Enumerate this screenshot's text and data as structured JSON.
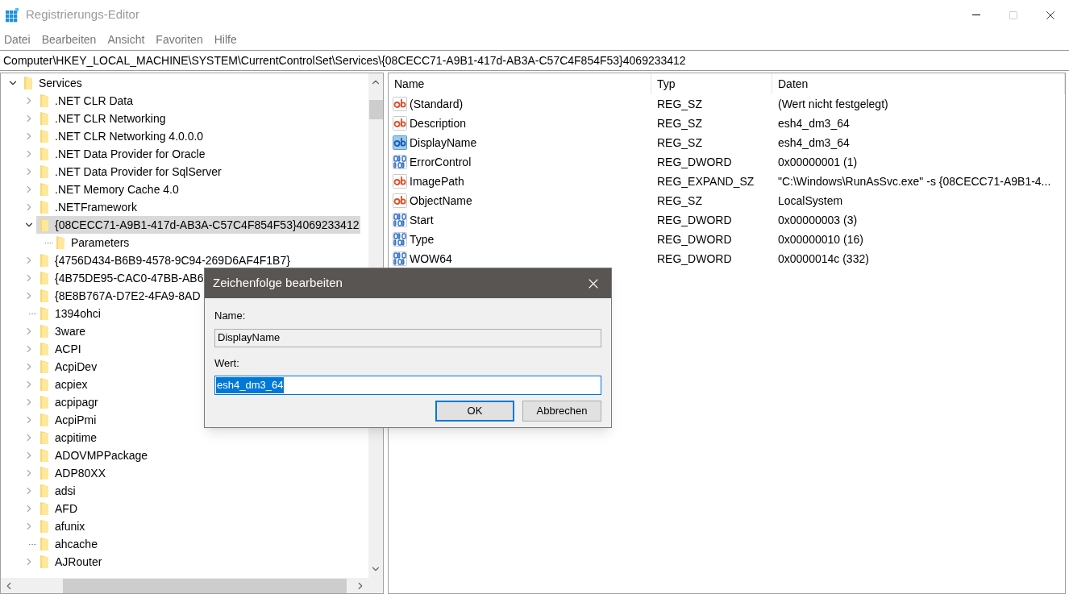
{
  "window": {
    "title": "Registrierungs-Editor"
  },
  "menu": [
    "Datei",
    "Bearbeiten",
    "Ansicht",
    "Favoriten",
    "Hilfe"
  ],
  "address": "Computer\\HKEY_LOCAL_MACHINE\\SYSTEM\\CurrentControlSet\\Services\\{08CECC71-A9B1-417d-AB3A-C57C4F854F53}4069233412",
  "tree": [
    {
      "label": "Services",
      "expanded": true,
      "selected": false,
      "children": [
        {
          "label": ".NET CLR Data",
          "expanded": false,
          "selected": false
        },
        {
          "label": ".NET CLR Networking",
          "expanded": false,
          "selected": false
        },
        {
          "label": ".NET CLR Networking 4.0.0.0",
          "expanded": false,
          "selected": false
        },
        {
          "label": ".NET Data Provider for Oracle",
          "expanded": false,
          "selected": false
        },
        {
          "label": ".NET Data Provider for SqlServer",
          "expanded": false,
          "selected": false
        },
        {
          "label": ".NET Memory Cache 4.0",
          "expanded": false,
          "selected": false
        },
        {
          "label": ".NETFramework",
          "expanded": false,
          "selected": false
        },
        {
          "label": "{08CECC71-A9B1-417d-AB3A-C57C4F854F53}4069233412",
          "expanded": true,
          "selected": true,
          "children": [
            {
              "label": "Parameters",
              "selected": false
            }
          ]
        },
        {
          "label": "{4756D434-B6B9-4578-9C94-269D6AF4F1B7}",
          "expanded": false,
          "selected": false
        },
        {
          "label": "{4B75DE95-CAC0-47BB-AB6",
          "expanded": false,
          "selected": false
        },
        {
          "label": "{8E8B767A-D7E2-4FA9-8AD",
          "expanded": false,
          "selected": false
        },
        {
          "label": "1394ohci",
          "selected": false
        },
        {
          "label": "3ware",
          "expanded": false,
          "selected": false
        },
        {
          "label": "ACPI",
          "expanded": false,
          "selected": false
        },
        {
          "label": "AcpiDev",
          "expanded": false,
          "selected": false
        },
        {
          "label": "acpiex",
          "expanded": false,
          "selected": false
        },
        {
          "label": "acpipagr",
          "expanded": false,
          "selected": false
        },
        {
          "label": "AcpiPmi",
          "expanded": false,
          "selected": false
        },
        {
          "label": "acpitime",
          "expanded": false,
          "selected": false
        },
        {
          "label": "ADOVMPPackage",
          "expanded": false,
          "selected": false
        },
        {
          "label": "ADP80XX",
          "expanded": false,
          "selected": false
        },
        {
          "label": "adsi",
          "expanded": false,
          "selected": false
        },
        {
          "label": "AFD",
          "expanded": false,
          "selected": false
        },
        {
          "label": "afunix",
          "expanded": false,
          "selected": false
        },
        {
          "label": "ahcache",
          "selected": false
        },
        {
          "label": "AJRouter",
          "expanded": false,
          "selected": false
        }
      ]
    }
  ],
  "values": {
    "columns": [
      "Name",
      "Typ",
      "Daten"
    ],
    "rows": [
      {
        "kind": "string",
        "name": "(Standard)",
        "type": "REG_SZ",
        "data": "(Wert nicht festgelegt)",
        "selected": false
      },
      {
        "kind": "string",
        "name": "Description",
        "type": "REG_SZ",
        "data": "esh4_dm3_64",
        "selected": false
      },
      {
        "kind": "string",
        "name": "DisplayName",
        "type": "REG_SZ",
        "data": "esh4_dm3_64",
        "selected": true
      },
      {
        "kind": "binary",
        "name": "ErrorControl",
        "type": "REG_DWORD",
        "data": "0x00000001 (1)",
        "selected": false
      },
      {
        "kind": "string",
        "name": "ImagePath",
        "type": "REG_EXPAND_SZ",
        "data": "\"C:\\Windows\\RunAsSvc.exe\" -s {08CECC71-A9B1-4...",
        "selected": false
      },
      {
        "kind": "string",
        "name": "ObjectName",
        "type": "REG_SZ",
        "data": "LocalSystem",
        "selected": false
      },
      {
        "kind": "binary",
        "name": "Start",
        "type": "REG_DWORD",
        "data": "0x00000003 (3)",
        "selected": false
      },
      {
        "kind": "binary",
        "name": "Type",
        "type": "REG_DWORD",
        "data": "0x00000010 (16)",
        "selected": false
      },
      {
        "kind": "binary",
        "name": "WOW64",
        "type": "REG_DWORD",
        "data": "0x0000014c (332)",
        "selected": false
      }
    ]
  },
  "dialog": {
    "title": "Zeichenfolge bearbeiten",
    "name_label": "Name:",
    "name_value": "DisplayName",
    "value_label": "Wert:",
    "value": "esh4_dm3_64",
    "value_selected": true,
    "buttons": [
      {
        "label": "OK",
        "default": true
      },
      {
        "label": "Abbrechen",
        "default": false
      }
    ]
  }
}
